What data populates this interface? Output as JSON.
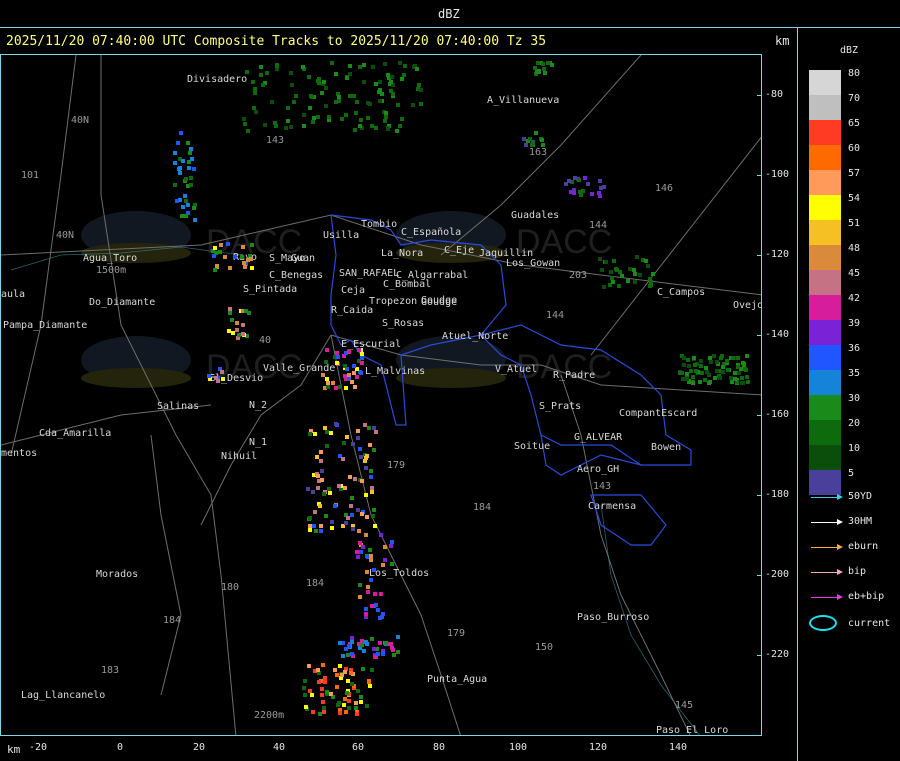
{
  "header": {
    "product": "dBZ",
    "title": "2025/11/20 07:40:00 UTC Composite Tracks to 2025/11/20 07:40:00 Tz 35",
    "km_label": "km"
  },
  "legend": {
    "title": "dBZ",
    "levels": [
      {
        "label": "80",
        "color": "#d6d6d6"
      },
      {
        "label": "70",
        "color": "#bfbfbf"
      },
      {
        "label": "65",
        "color": "#ff3b24"
      },
      {
        "label": "60",
        "color": "#ff6a00"
      },
      {
        "label": "57",
        "color": "#ff9a5a"
      },
      {
        "label": "54",
        "color": "#ffff00"
      },
      {
        "label": "51",
        "color": "#f5c023"
      },
      {
        "label": "48",
        "color": "#d98a3a"
      },
      {
        "label": "45",
        "color": "#c47284"
      },
      {
        "label": "42",
        "color": "#d61d9b"
      },
      {
        "label": "39",
        "color": "#7a22d6"
      },
      {
        "label": "36",
        "color": "#1f56ff"
      },
      {
        "label": "35",
        "color": "#1584d8"
      },
      {
        "label": "30",
        "color": "#1a8a1a"
      },
      {
        "label": "20",
        "color": "#0d6b0d"
      },
      {
        "label": "10",
        "color": "#0b4d0b"
      },
      {
        "label": "5",
        "color": "#4a3f9a"
      }
    ],
    "tracks": [
      {
        "label": "50YD",
        "color": "#3fd0e8"
      },
      {
        "label": "30HM",
        "color": "#ffffff"
      },
      {
        "label": "eburn",
        "color": "#f2b23c"
      },
      {
        "label": "bip",
        "color": "#f7a8c8"
      },
      {
        "label": "eb+bip",
        "color": "#e83ce8"
      }
    ],
    "current_label": "current"
  },
  "axes": {
    "y_ticks": [
      "-80",
      "-100",
      "-120",
      "-140",
      "-160",
      "-180",
      "-200",
      "-220"
    ],
    "x_ticks": [
      "-20",
      "0",
      "20",
      "40",
      "60",
      "80",
      "100",
      "120",
      "140"
    ],
    "x_unit": "km",
    "y_unit": "km"
  },
  "places": [
    "Divisadero",
    "A_Villanueva",
    "Guadales",
    "Tombio",
    "C_Española",
    "C_Eje",
    "Jaquillin",
    "Usilla",
    "La_Nora",
    "Agua_Toro",
    "Rayo",
    "Guan",
    "S_Mayo",
    "C_Benegas",
    "SAN_RAFAEL",
    "C_Algarrabal",
    "Goudge",
    "C_Bombal",
    "S_Pintada",
    "Ceja",
    "Tropezon",
    "Goudge",
    "Los_Gowan",
    "C_Campos",
    "Ovejo",
    "Pampa_Diamante",
    "R_Caida",
    "S_Rosas",
    "Atuel_Norte",
    "E_Escurial",
    "El_Desvio",
    "Valle_Grande",
    "L_Malvinas",
    "V_Atuel",
    "R_Padre",
    "Salinas",
    "N_2",
    "N_1",
    "Nihuil",
    "Cda_Amarilla",
    "mentos",
    "S_Prats",
    "CompantEscard",
    "Bowen",
    "G_ALVEAR",
    "Soitue",
    "Aero_GH",
    "Carmensa",
    "Morados",
    "Los_Toldos",
    "Paso_Burroso",
    "Punta_Agua",
    "Lag_Llancanelo",
    "Paso_El_Loro",
    "aula",
    "Do_Diamante"
  ],
  "roads": [
    "101",
    "40N",
    "143",
    "40N",
    "163",
    "146",
    "144",
    "1500m",
    "40",
    "184",
    "203",
    "179",
    "180",
    "184",
    "179",
    "150",
    "143",
    "183",
    "2200m",
    "184",
    "144",
    "145"
  ]
}
